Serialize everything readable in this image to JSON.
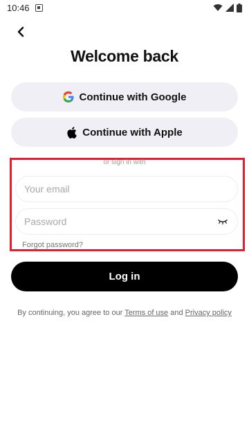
{
  "status_bar": {
    "time": "10:46",
    "icons": [
      "notification-icon",
      "wifi-icon",
      "signal-icon",
      "battery-icon"
    ]
  },
  "header": {
    "back_icon": "chevron-left-icon",
    "title": "Welcome back"
  },
  "social": {
    "google_label": "Continue with Google",
    "apple_label": "Continue with Apple"
  },
  "form": {
    "divider_text": "or sign in with",
    "email_placeholder": "Your email",
    "email_value": "",
    "password_placeholder": "Password",
    "password_value": "",
    "password_toggle_icon": "eye-closed-icon",
    "forgot_password": "Forgot password?"
  },
  "actions": {
    "login_label": "Log in"
  },
  "terms": {
    "prefix": "By continuing, you agree to our",
    "terms_link": "Terms of use",
    "conjunction": "and",
    "privacy_link": "Privacy policy"
  },
  "colors": {
    "accent_highlight": "#e0202e",
    "button_bg": "#f0eff6",
    "primary_button": "#000000"
  }
}
